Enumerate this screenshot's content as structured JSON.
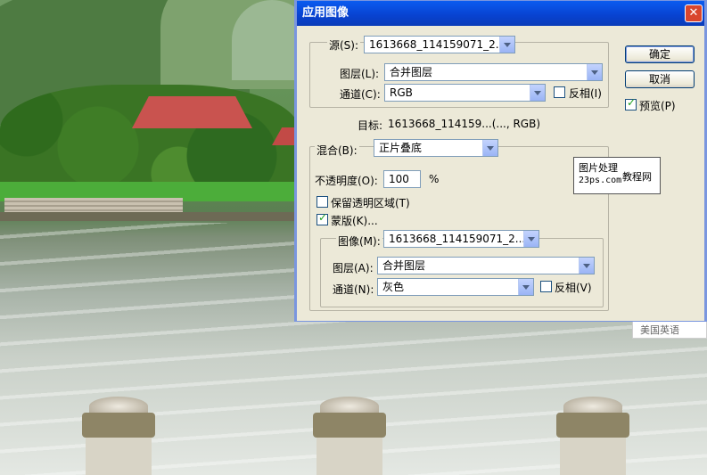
{
  "dialog": {
    "title": "应用图像",
    "close_glyph": "✕",
    "source": {
      "label": "源(S):",
      "value": "1613668_114159071_2..."
    },
    "source_layer": {
      "label": "图层(L):",
      "value": "合并图层"
    },
    "source_channel": {
      "label": "通道(C):",
      "value": "RGB",
      "invert_label": "反相(I)",
      "invert_checked": false
    },
    "target": {
      "label": "目标:",
      "value": "1613668_114159...(..., RGB)"
    },
    "blending": {
      "label": "混合(B):",
      "value": "正片叠底"
    },
    "opacity": {
      "label": "不透明度(O):",
      "value": "100",
      "unit": "%"
    },
    "preserve_transparency": {
      "label": "保留透明区域(T)",
      "checked": false
    },
    "mask": {
      "label": "蒙版(K)...",
      "checked": true
    },
    "mask_image": {
      "label": "图像(M):",
      "value": "1613668_114159071_2..."
    },
    "mask_layer": {
      "label": "图层(A):",
      "value": "合并图层"
    },
    "mask_channel": {
      "label": "通道(N):",
      "value": "灰色",
      "invert_label": "反相(V)",
      "invert_checked": false
    },
    "ok_label": "确定",
    "cancel_label": "取消",
    "preview": {
      "label": "预览(P)",
      "checked": true
    }
  },
  "watermark": {
    "line1": "图片处理",
    "line2": "23ps.com",
    "line3": "教程网"
  },
  "overlay_text": "美国英语"
}
